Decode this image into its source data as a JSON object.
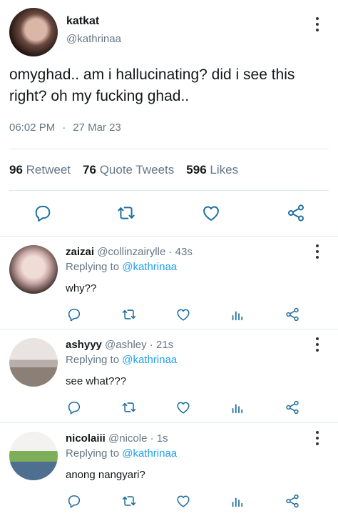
{
  "tweet": {
    "display_name": "katkat",
    "handle": "@kathrinaa",
    "text": "omyghad.. am i hallucinating? did i see this right? oh my fucking ghad..",
    "time": "06:02 PM",
    "separator": "·",
    "date": "27 Mar 23",
    "stats": {
      "retweets_count": "96",
      "retweets_label": "Retweet",
      "quotes_count": "76",
      "quotes_label": "Quote Tweets",
      "likes_count": "596",
      "likes_label": "Likes"
    },
    "icons": [
      "reply-icon",
      "retweet-icon",
      "like-icon",
      "share-icon"
    ]
  },
  "replies": [
    {
      "display_name": "zaizai",
      "handle": "@collinzairylle",
      "age": "· 43s",
      "replying_prefix": "Replying to",
      "replying_handle": "@kathrinaa",
      "text": "why??"
    },
    {
      "display_name": "ashyyy",
      "handle": "@ashley",
      "age": "· 21s",
      "replying_prefix": "Replying to",
      "replying_handle": "@kathrinaa",
      "text": "see what???"
    },
    {
      "display_name": "nicolaiii",
      "handle": "@nicole",
      "age": "· 1s",
      "replying_prefix": "Replying to",
      "replying_handle": "@kathrinaa",
      "text": "anong nangyari?"
    }
  ],
  "reply_icons": [
    "reply-icon",
    "retweet-icon",
    "like-icon",
    "analytics-icon",
    "share-icon"
  ],
  "colors": {
    "link": "#1da1f2",
    "muted": "#657786",
    "icon": "#1f6f9e",
    "divider": "#e1e8ed"
  }
}
